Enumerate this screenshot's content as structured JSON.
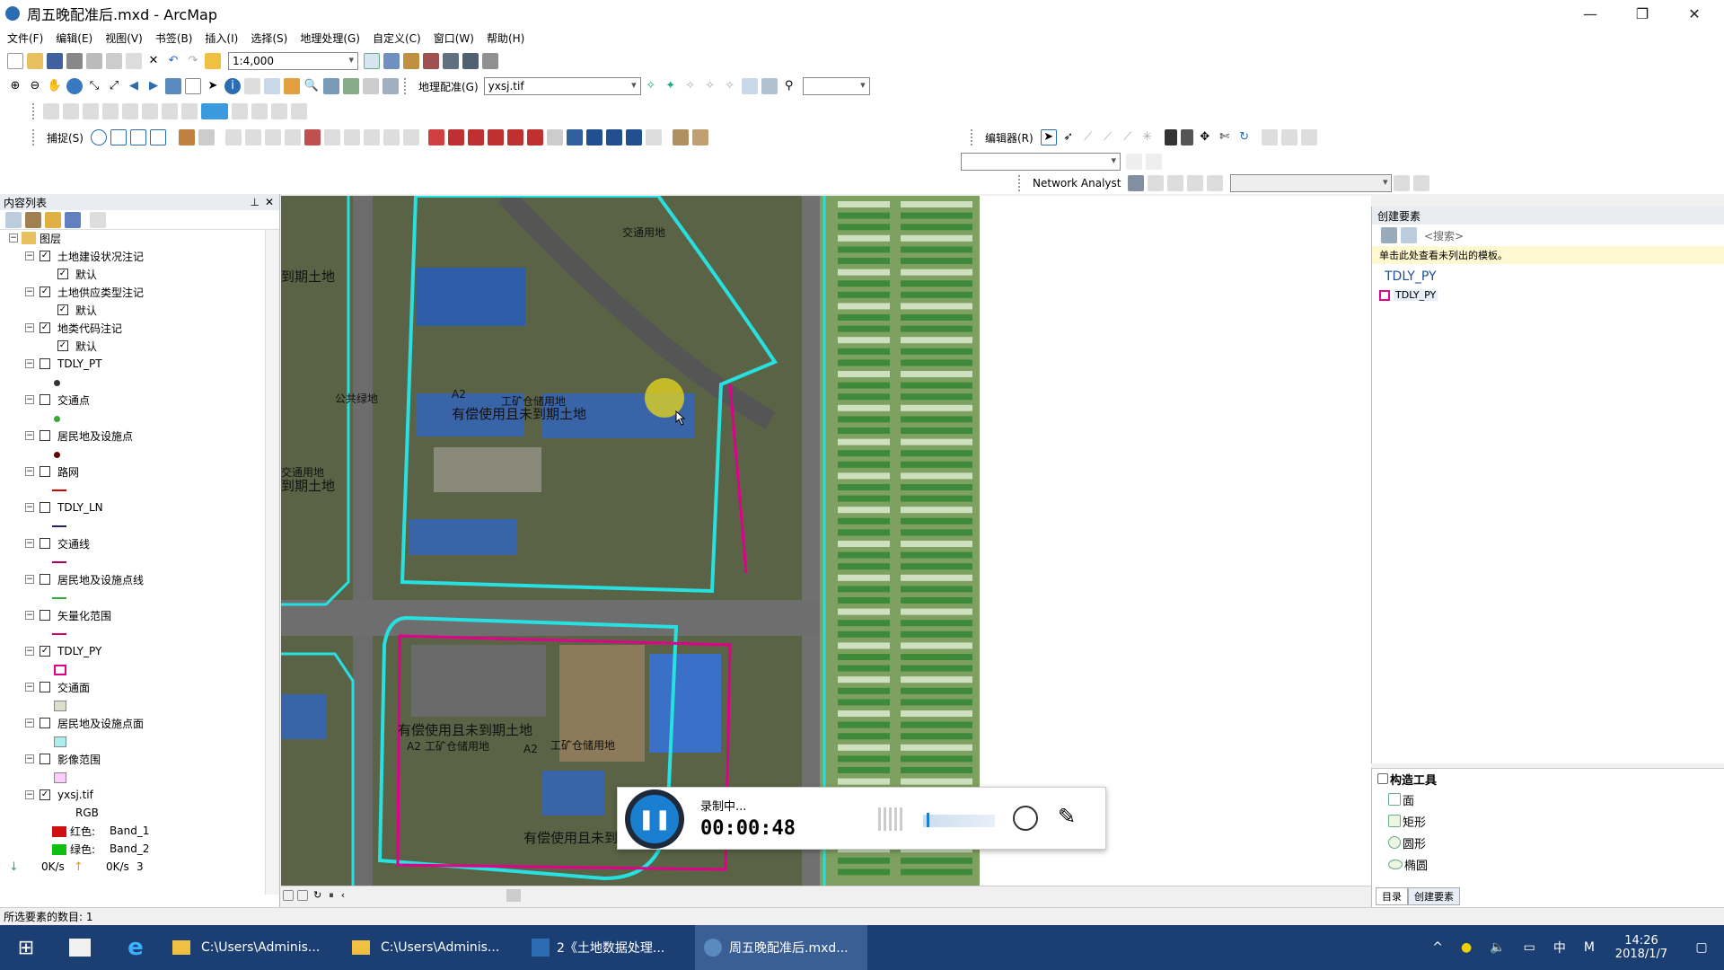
{
  "app": {
    "title": "周五晚配准后.mxd - ArcMap",
    "minimize": "—",
    "restore": "❐",
    "close": "✕"
  },
  "menu": [
    "文件(F)",
    "编辑(E)",
    "视图(V)",
    "书签(B)",
    "插入(I)",
    "选择(S)",
    "地理处理(G)",
    "自定义(C)",
    "窗口(W)",
    "帮助(H)"
  ],
  "toolbar": {
    "scale": "1:4,000",
    "georef_label": "地理配准(G)",
    "georef_layer": "yxsj.tif",
    "snap_label": "捕捉(S)",
    "editor_label": "编辑器(R)",
    "network_label": "Network Analyst"
  },
  "toc": {
    "title": "内容列表",
    "root": "图层",
    "layers": [
      {
        "name": "土地建设状况注记",
        "checked": true,
        "sub": "默认"
      },
      {
        "name": "土地供应类型注记",
        "checked": true,
        "sub": "默认"
      },
      {
        "name": "地类代码注记",
        "checked": true,
        "sub": "默认"
      },
      {
        "name": "TDLY_PT",
        "checked": false
      },
      {
        "name": "交通点",
        "checked": false
      },
      {
        "name": "居民地及设施点",
        "checked": false
      },
      {
        "name": "路网",
        "checked": false
      },
      {
        "name": "TDLY_LN",
        "checked": false
      },
      {
        "name": "交通线",
        "checked": false
      },
      {
        "name": "居民地及设施点线",
        "checked": false
      },
      {
        "name": "矢量化范围",
        "checked": false
      },
      {
        "name": "TDLY_PY",
        "checked": true
      },
      {
        "name": "交通面",
        "checked": false
      },
      {
        "name": "居民地及设施点面",
        "checked": false
      },
      {
        "name": "影像范围",
        "checked": false
      },
      {
        "name": "yxsj.tif",
        "checked": true
      }
    ],
    "raster_rgb": "RGB",
    "bands": [
      {
        "label": "红色:",
        "value": "Band_1"
      },
      {
        "label": "绿色:",
        "value": "Band_2"
      }
    ],
    "net_down": "0K/s",
    "net_up": "0K/s",
    "net_extra": "3"
  },
  "map": {
    "labels": [
      "有偿使用且未到期土地",
      "工矿仓储用地",
      "A2",
      "有偿使用且未到期土地",
      "A2",
      "工矿仓储用地",
      "A2",
      "工矿仓储用地",
      "到期土地",
      "公共绿地",
      "到期土地",
      "有偿使用且未到期土地",
      "交通用地",
      "交通用地"
    ]
  },
  "create_features": {
    "title": "创建要素",
    "search_placeholder": "<搜索>",
    "hint": "单击此处查看未列出的模板。",
    "group": "TDLY_PY",
    "item": "TDLY_PY"
  },
  "construct_tools": {
    "title": "构造工具",
    "items": [
      "面",
      "矩形",
      "圆形",
      "椭圆"
    ],
    "tab_catalog": "目录",
    "tab_create": "创建要素"
  },
  "status": {
    "text": "所选要素的数目: 1"
  },
  "recorder": {
    "state": "录制中...",
    "time": "00:00:48"
  },
  "taskbar": {
    "items": [
      "C:\\Users\\Adminis...",
      "C:\\Users\\Adminis...",
      "2《土地数据处理...",
      "周五晚配准后.mxd..."
    ],
    "time": "14:26",
    "date": "2018/1/7",
    "ime": "中",
    "ime2": "M"
  },
  "colors": {
    "titlebar": "#ffffff",
    "taskbar": "#1c3f73",
    "cyan": "#27e0e0",
    "magenta": "#e0008a",
    "accent": "#1a7fd0"
  }
}
